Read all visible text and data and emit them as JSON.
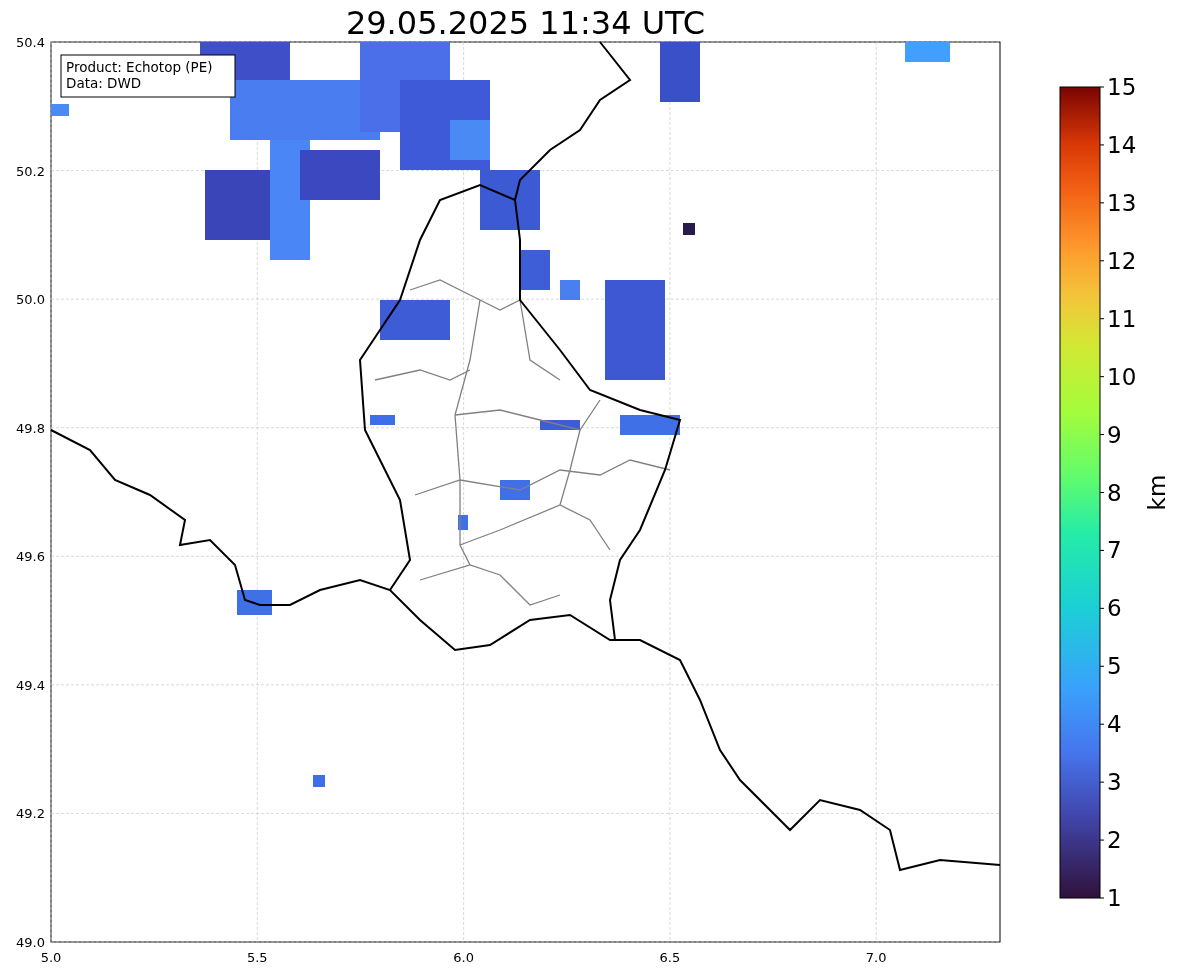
{
  "title": "29.05.2025 11:34 UTC",
  "info_box": [
    "Product: Echotop (PE)",
    "Data: DWD"
  ],
  "map": {
    "xticks": [
      "5.0",
      "5.5",
      "6.0",
      "6.5",
      "7.0"
    ],
    "yticks": [
      "50.4",
      "50.2",
      "50.0",
      "49.8",
      "49.6",
      "49.4",
      "49.2",
      "49.0"
    ]
  },
  "colorbar": {
    "label": "km",
    "ticks": [
      "15",
      "14",
      "13",
      "12",
      "11",
      "10",
      "9",
      "8",
      "7",
      "6",
      "5",
      "4",
      "3",
      "2",
      "1"
    ]
  }
}
